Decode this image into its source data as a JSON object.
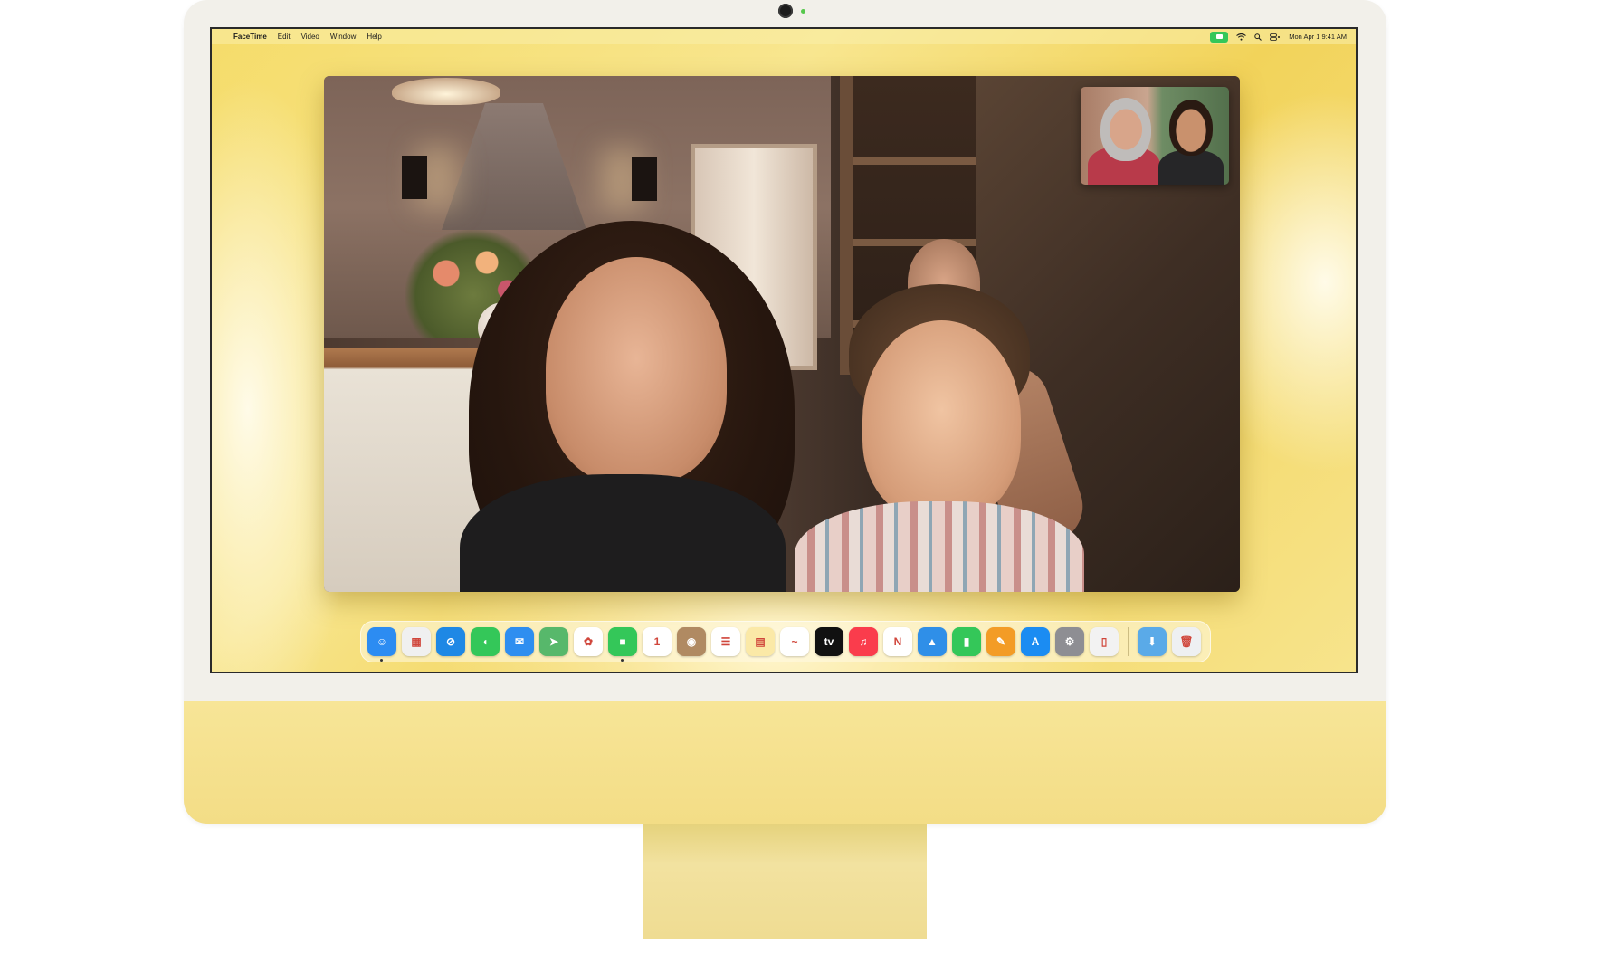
{
  "menubar": {
    "apple_glyph": "",
    "app_name": "FaceTime",
    "menus": [
      "Edit",
      "Video",
      "Window",
      "Help"
    ],
    "clock": "Mon Apr 1  9:41 AM"
  },
  "dock": {
    "apps": [
      {
        "name": "Finder",
        "icon": "finder-icon",
        "color": "#2c8cf2",
        "glyph": "☺",
        "running": true
      },
      {
        "name": "Launchpad",
        "icon": "launchpad-icon",
        "color": "#f0f0f0",
        "glyph": "▦",
        "running": false
      },
      {
        "name": "Safari",
        "icon": "safari-icon",
        "color": "#1e88e5",
        "glyph": "⊘",
        "running": false
      },
      {
        "name": "Messages",
        "icon": "messages-icon",
        "color": "#34c759",
        "glyph": "◖",
        "running": false
      },
      {
        "name": "Mail",
        "icon": "mail-icon",
        "color": "#2e8ef0",
        "glyph": "✉",
        "running": false
      },
      {
        "name": "Maps",
        "icon": "maps-icon",
        "color": "#57b86b",
        "glyph": "➤",
        "running": false
      },
      {
        "name": "Photos",
        "icon": "photos-icon",
        "color": "#ffffff",
        "glyph": "✿",
        "running": false
      },
      {
        "name": "FaceTime",
        "icon": "facetime-icon",
        "color": "#34c759",
        "glyph": "■",
        "running": true
      },
      {
        "name": "Calendar",
        "icon": "calendar-icon",
        "color": "#ffffff",
        "glyph": "1",
        "running": false
      },
      {
        "name": "Contacts",
        "icon": "contacts-icon",
        "color": "#b08a62",
        "glyph": "◉",
        "running": false
      },
      {
        "name": "Reminders",
        "icon": "reminders-icon",
        "color": "#ffffff",
        "glyph": "☰",
        "running": false
      },
      {
        "name": "Notes",
        "icon": "notes-icon",
        "color": "#fbe9a7",
        "glyph": "▤",
        "running": false
      },
      {
        "name": "Freeform",
        "icon": "freeform-icon",
        "color": "#ffffff",
        "glyph": "~",
        "running": false
      },
      {
        "name": "TV",
        "icon": "appletv-icon",
        "color": "#111111",
        "glyph": "tv",
        "running": false
      },
      {
        "name": "Music",
        "icon": "music-icon",
        "color": "#fa3c4c",
        "glyph": "♫",
        "running": false
      },
      {
        "name": "News",
        "icon": "news-icon",
        "color": "#ffffff",
        "glyph": "N",
        "running": false
      },
      {
        "name": "Keynote",
        "icon": "keynote-icon",
        "color": "#2f8fe8",
        "glyph": "▲",
        "running": false
      },
      {
        "name": "Numbers",
        "icon": "numbers-icon",
        "color": "#34c759",
        "glyph": "▮",
        "running": false
      },
      {
        "name": "Pages",
        "icon": "pages-icon",
        "color": "#f39c26",
        "glyph": "✎",
        "running": false
      },
      {
        "name": "App Store",
        "icon": "appstore-icon",
        "color": "#1b8cf2",
        "glyph": "A",
        "running": false
      },
      {
        "name": "System Settings",
        "icon": "settings-icon",
        "color": "#8e8e93",
        "glyph": "⚙",
        "running": false
      },
      {
        "name": "iPhone Mirroring",
        "icon": "iphone-mirroring-icon",
        "color": "#f2f2f2",
        "glyph": "▯",
        "running": false
      }
    ],
    "trailing": [
      {
        "name": "Downloads",
        "icon": "downloads-folder-icon",
        "color": "#5aaae8",
        "glyph": "⬇"
      },
      {
        "name": "Trash",
        "icon": "trash-icon",
        "color": "#eef0f2",
        "glyph": "🗑"
      }
    ]
  },
  "colors": {
    "wallpaper": "#f5dc6a",
    "chassis": "#f3dd86",
    "facetime_green": "#34c759"
  }
}
